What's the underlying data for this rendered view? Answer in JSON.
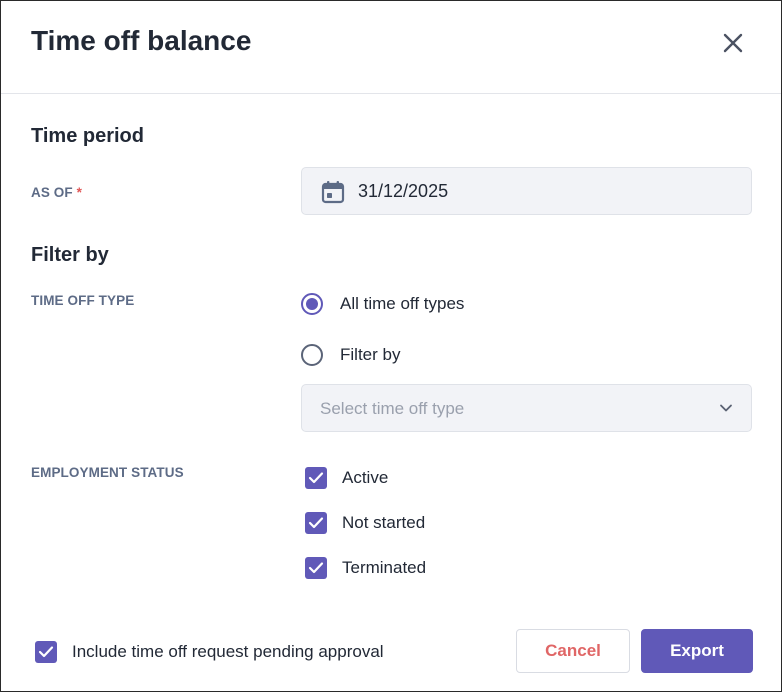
{
  "dialog": {
    "title": "Time off balance",
    "close_icon": "close-icon"
  },
  "time_period": {
    "heading": "Time period",
    "as_of_label": "AS OF",
    "required_mark": "*",
    "date_icon": "calendar-icon",
    "date_value": "31/12/2025"
  },
  "filter": {
    "heading": "Filter by",
    "time_off_type_label": "TIME OFF TYPE",
    "options": [
      {
        "label": "All time off types",
        "selected": true
      },
      {
        "label": "Filter by",
        "selected": false
      }
    ],
    "select_placeholder": "Select time off type",
    "select_icon": "chevron-down-icon",
    "employment_status_label": "EMPLOYMENT STATUS",
    "statuses": [
      {
        "label": "Active",
        "checked": true
      },
      {
        "label": "Not started",
        "checked": true
      },
      {
        "label": "Terminated",
        "checked": true
      }
    ]
  },
  "footer": {
    "include_pending_label": "Include time off request pending approval",
    "include_pending_checked": true,
    "cancel_label": "Cancel",
    "export_label": "Export"
  },
  "colors": {
    "accent": "#6059b8",
    "cancel_text": "#e06666",
    "label_text": "#5d6b86",
    "required": "#e05656"
  }
}
